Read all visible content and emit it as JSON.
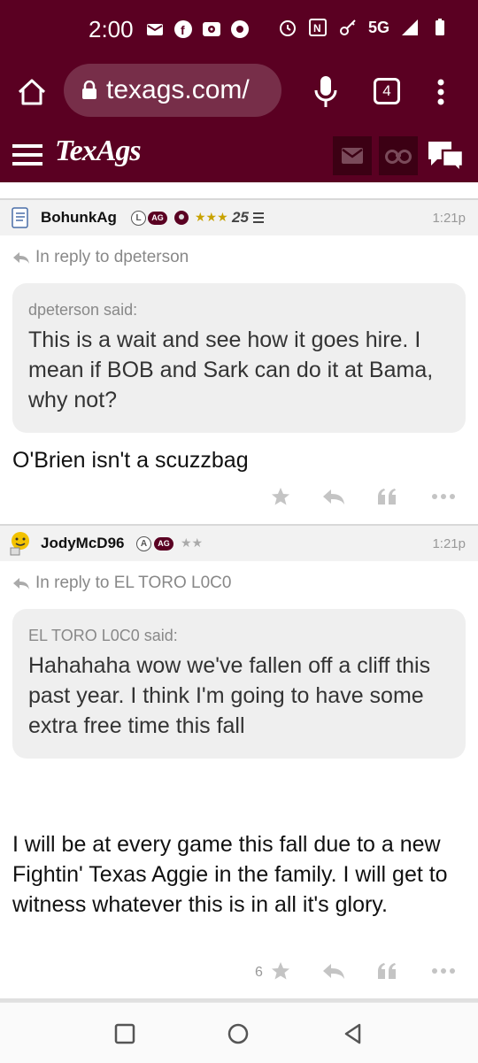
{
  "colors": {
    "maroon": "#5a0022",
    "maroon_dark": "#3c0014",
    "gold_stars": "#c8a200"
  },
  "status_bar": {
    "time": "2:00",
    "network": "5G",
    "left_icons": [
      "mail-icon",
      "facebook-icon",
      "radio-icon",
      "chrome-icon"
    ],
    "right_icons": [
      "alarm-icon",
      "nfc-icon",
      "key-icon",
      "data-arrows-icon",
      "signal-icon",
      "battery-icon"
    ]
  },
  "browser": {
    "url": "texags.com/",
    "tab_count": "4"
  },
  "site": {
    "logo": "TexAgs"
  },
  "posts": [
    {
      "username": "BohunkAg",
      "badges": [
        "L",
        "AG"
      ],
      "stars": "★★★",
      "extra": "25",
      "time": "1:21p",
      "reply_to": "In reply to dpeterson",
      "quote_said": "dpeterson said:",
      "quote_text": "This is a wait and see how it goes hire. I mean if BOB and Sark can do it at Bama, why not?",
      "body": "O'Brien isn't a scuzzbag",
      "star_count": ""
    },
    {
      "username": "JodyMcD96",
      "badges": [
        "A",
        "AG"
      ],
      "stars": "★★",
      "extra": "",
      "time": "1:21p",
      "reply_to": "In reply to EL TORO L0C0",
      "quote_said": "EL TORO L0C0 said:",
      "quote_text": "Hahahaha wow we've fallen off a cliff this past year. I think I'm going to have some extra free time this fall",
      "body": "I will be at every game this fall due to a new Fightin' Texas Aggie in the family. I will get to witness whatever this is in all it's glory.",
      "star_count": "6"
    }
  ]
}
